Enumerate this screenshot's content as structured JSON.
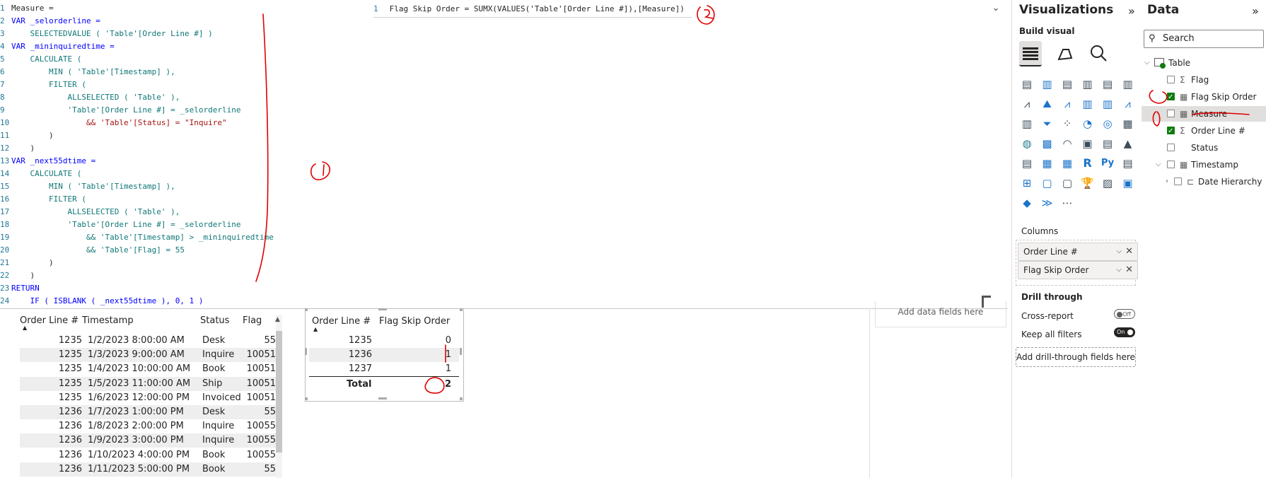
{
  "editor": {
    "measure_header": "Measure =",
    "lines": [
      {
        "n": "1",
        "text": "Measure ="
      },
      {
        "n": "2",
        "text": "VAR _selorderline ="
      },
      {
        "n": "3",
        "text": "    SELECTEDVALUE ( 'Table'[Order Line #] )"
      },
      {
        "n": "4",
        "text": "VAR _mininquiredtime ="
      },
      {
        "n": "5",
        "text": "    CALCULATE ("
      },
      {
        "n": "6",
        "text": "        MIN ( 'Table'[Timestamp] ),"
      },
      {
        "n": "7",
        "text": "        FILTER ("
      },
      {
        "n": "8",
        "text": "            ALLSELECTED ( 'Table' ),"
      },
      {
        "n": "9",
        "text": "            'Table'[Order Line #] = _selorderline"
      },
      {
        "n": "10",
        "text": "                && 'Table'[Status] = \"Inquire\""
      },
      {
        "n": "11",
        "text": "        )"
      },
      {
        "n": "12",
        "text": "    )"
      },
      {
        "n": "13",
        "text": "VAR _next55dtime ="
      },
      {
        "n": "14",
        "text": "    CALCULATE ("
      },
      {
        "n": "15",
        "text": "        MIN ( 'Table'[Timestamp] ),"
      },
      {
        "n": "16",
        "text": "        FILTER ("
      },
      {
        "n": "17",
        "text": "            ALLSELECTED ( 'Table' ),"
      },
      {
        "n": "18",
        "text": "            'Table'[Order Line #] = _selorderline"
      },
      {
        "n": "19",
        "text": "                && 'Table'[Timestamp] > _mininquiredtime"
      },
      {
        "n": "20",
        "text": "                && 'Table'[Flag] = 55"
      },
      {
        "n": "21",
        "text": "        )"
      },
      {
        "n": "22",
        "text": "    )"
      },
      {
        "n": "23",
        "text": "RETURN"
      },
      {
        "n": "24",
        "text": "    IF ( ISBLANK ( _next55dtime ), 0, 1 )"
      }
    ],
    "formula2_line_number": "1",
    "formula2": "Flag Skip Order = SUMX(VALUES('Table'[Order Line #]),[Measure])"
  },
  "table1": {
    "columns": [
      "Order Line #",
      "Timestamp",
      "Status",
      "Flag"
    ],
    "rows": [
      [
        "1235",
        "1/2/2023 8:00:00 AM",
        "Desk",
        "55"
      ],
      [
        "1235",
        "1/3/2023 9:00:00 AM",
        "Inquire",
        "10051"
      ],
      [
        "1235",
        "1/4/2023 10:00:00 AM",
        "Book",
        "10051"
      ],
      [
        "1235",
        "1/5/2023 11:00:00 AM",
        "Ship",
        "10051"
      ],
      [
        "1235",
        "1/6/2023 12:00:00 PM",
        "Invoiced",
        "10051"
      ],
      [
        "1236",
        "1/7/2023 1:00:00 PM",
        "Desk",
        "55"
      ],
      [
        "1236",
        "1/8/2023 2:00:00 PM",
        "Inquire",
        "10055"
      ],
      [
        "1236",
        "1/9/2023 3:00:00 PM",
        "Inquire",
        "10055"
      ],
      [
        "1236",
        "1/10/2023 4:00:00 PM",
        "Book",
        "10055"
      ],
      [
        "1236",
        "1/11/2023 5:00:00 PM",
        "Book",
        "55"
      ]
    ]
  },
  "table2": {
    "columns": [
      "Order Line #",
      "Flag Skip Order"
    ],
    "rows": [
      [
        "1235",
        "0"
      ],
      [
        "1236",
        "1"
      ],
      [
        "1237",
        "1"
      ]
    ],
    "total_label": "Total",
    "total_value": "2"
  },
  "other_visual": {
    "placeholder": "Add data fields here"
  },
  "visualizations": {
    "title": "Visualizations",
    "build_visual": "Build visual",
    "columns_label": "Columns",
    "column_fields": [
      "Order Line #",
      "Flag Skip Order"
    ],
    "drill_through": "Drill through",
    "cross_report": "Cross-report",
    "cross_report_state": "Off",
    "keep_all_filters": "Keep all filters",
    "keep_all_filters_state": "On",
    "drill_button": "Add drill-through fields here",
    "more": "..."
  },
  "data_pane": {
    "title": "Data",
    "search_placeholder": "Search",
    "table_name": "Table",
    "fields": [
      {
        "name": "Flag",
        "checked": false,
        "icon": "sigma-icon"
      },
      {
        "name": "Flag Skip Order",
        "checked": true,
        "icon": "calculator-icon"
      },
      {
        "name": "Measure",
        "checked": false,
        "icon": "calculator-icon"
      },
      {
        "name": "Order Line #",
        "checked": true,
        "icon": "sigma-icon"
      },
      {
        "name": "Status",
        "checked": false,
        "icon": ""
      },
      {
        "name": "Timestamp",
        "checked": false,
        "icon": "calendar-icon"
      },
      {
        "name": "Date Hierarchy",
        "checked": false,
        "icon": "hierarchy-icon"
      }
    ]
  },
  "colors": {
    "accent": "#107c10",
    "ink": "#e00000",
    "keyword": "#0000ff",
    "variable": "#117777",
    "string": "#a31515"
  }
}
